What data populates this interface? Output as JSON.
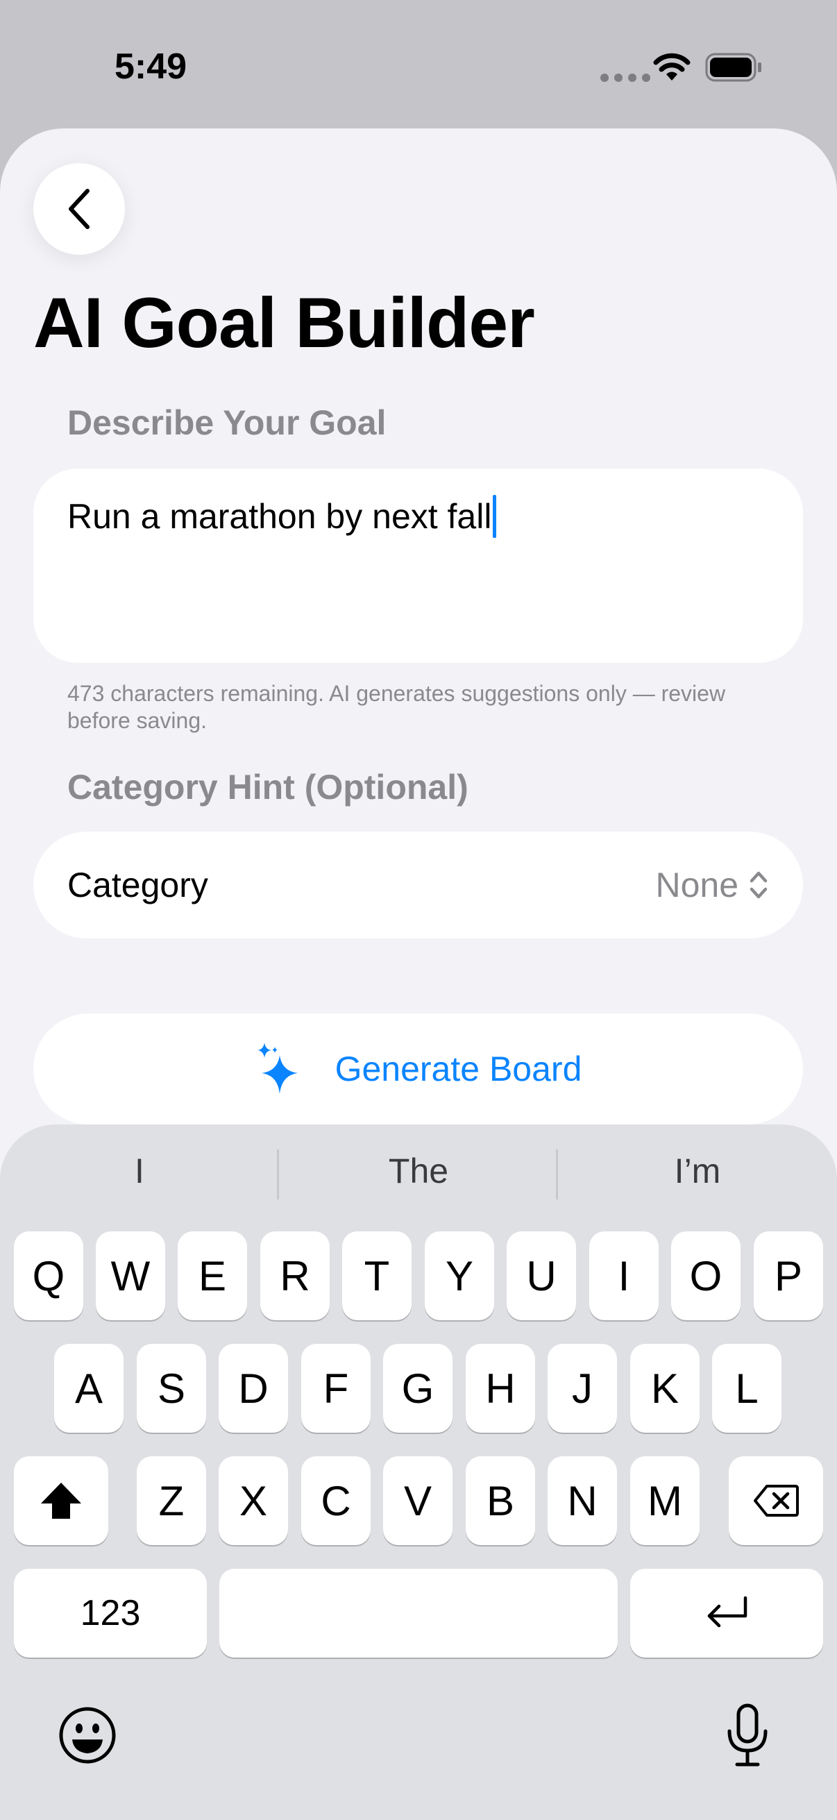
{
  "status_bar": {
    "time": "5:49"
  },
  "page": {
    "title": "AI Goal Builder",
    "goal_section_label": "Describe Your Goal",
    "goal_text": "Run a marathon by next fall",
    "helper_text": "473 characters remaining. AI generates suggestions only — review before saving.",
    "category_section_label": "Category Hint (Optional)",
    "category_label": "Category",
    "category_value": "None",
    "generate_label": "Generate Board"
  },
  "colors": {
    "accent": "#0a84ff",
    "background": "#f2f2f7",
    "keyboard": "#dfe0e4"
  },
  "icons": {
    "back": "chevron-left-icon",
    "generate": "sparkles-icon",
    "picker": "chevron-up-down-icon",
    "shift": "shift-icon",
    "delete": "delete-icon",
    "return": "return-icon",
    "emoji": "emoji-icon",
    "mic": "microphone-icon"
  },
  "keyboard": {
    "suggestions": [
      "I",
      "The",
      "I’m"
    ],
    "row1": [
      "Q",
      "W",
      "E",
      "R",
      "T",
      "Y",
      "U",
      "I",
      "O",
      "P"
    ],
    "row2": [
      "A",
      "S",
      "D",
      "F",
      "G",
      "H",
      "J",
      "K",
      "L"
    ],
    "row3": [
      "Z",
      "X",
      "C",
      "V",
      "B",
      "N",
      "M"
    ],
    "numbers_label": "123"
  }
}
